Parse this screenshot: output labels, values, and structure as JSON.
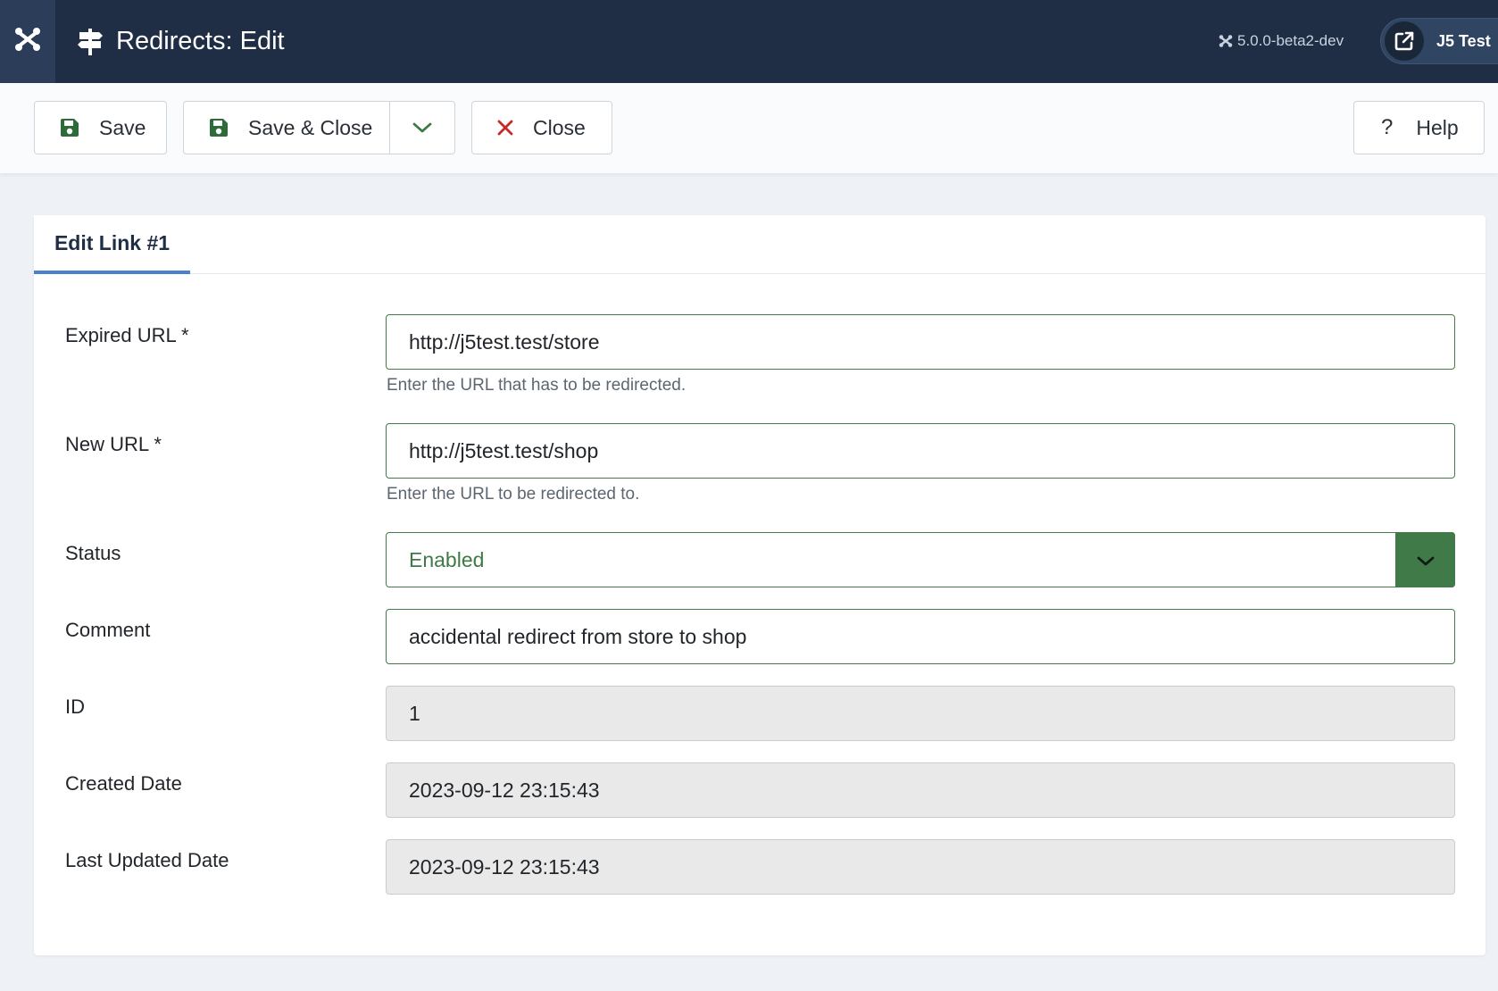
{
  "header": {
    "logo_icon": "joomla-logo-icon",
    "title_icon": "signpost-icon",
    "title": "Redirects: Edit",
    "version": "5.0.0-beta2-dev",
    "site_button_label": "J5 Test",
    "site_icon": "external-link-icon",
    "colors": {
      "background": "#1f2e45",
      "logo_box": "#2b3d59"
    }
  },
  "toolbar": {
    "save_label": "Save",
    "save_close_label": "Save & Close",
    "close_label": "Close",
    "help_label": "Help",
    "help_icon_glyph": "?",
    "icons": {
      "save": "save-disk-icon",
      "save_close": "save-disk-icon",
      "dropdown": "chevron-down-icon",
      "close": "close-x-icon",
      "help": "question-icon"
    },
    "colors": {
      "save_icon": "#2e6b3a",
      "close_icon": "#c52a2a",
      "dropdown_chevron": "#3d7a44"
    }
  },
  "tabs": [
    {
      "label": "Edit Link #1",
      "active": true
    }
  ],
  "form": {
    "expired_url": {
      "label": "Expired URL *",
      "value": "http://j5test.test/store",
      "help": "Enter the URL that has to be redirected."
    },
    "new_url": {
      "label": "New URL *",
      "value": "http://j5test.test/shop",
      "help": "Enter the URL to be redirected to."
    },
    "status": {
      "label": "Status",
      "value": "Enabled"
    },
    "comment": {
      "label": "Comment",
      "value": "accidental redirect from store to shop"
    },
    "id": {
      "label": "ID",
      "value": "1"
    },
    "created_date": {
      "label": "Created Date",
      "value": "2023-09-12 23:15:43"
    },
    "last_updated_date": {
      "label": "Last Updated Date",
      "value": "2023-09-12 23:15:43"
    },
    "colors": {
      "input_border": "#467a4a",
      "status_text": "#3d7a44",
      "select_button": "#3f7a48",
      "readonly_bg": "#e9e9e9"
    }
  }
}
